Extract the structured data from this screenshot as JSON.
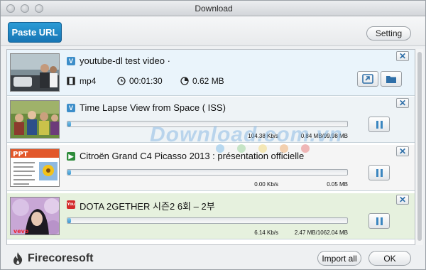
{
  "window": {
    "title": "Download"
  },
  "toolbar": {
    "paste_label": "Paste URL",
    "setting_label": "Setting"
  },
  "downloads": [
    {
      "source_icon": "vimeo-icon",
      "title": "youtube-dl test video ·",
      "format": "mp4",
      "duration": "00:01:30",
      "size": "0.62 MB",
      "status": "completed"
    },
    {
      "source_icon": "vimeo-icon",
      "title": "Time Lapse View from Space ( ISS)",
      "speed": "104.38 Kb/s",
      "progress_text": "0.84 MB/99.98 MB",
      "progress": 0.0084,
      "status": "downloading"
    },
    {
      "source_icon": "dailymotion-icon",
      "title": "Citroën Grand C4 Picasso 2013 : présentation officielle",
      "speed": "0.00 Kb/s",
      "progress_text": "0.05 MB",
      "progress": 0.005,
      "status": "downloading"
    },
    {
      "source_icon": "youtube-icon",
      "title": "DOTA 2GETHER 시즌2 6회 – 2부",
      "speed": "6.14 Kb/s",
      "progress_text": "2.47 MB/1062.04 MB",
      "progress": 0.0023,
      "status": "downloading"
    }
  ],
  "footer": {
    "brand": "Firecoresoft",
    "import_label": "Import all",
    "ok_label": "OK"
  },
  "watermark": {
    "text": "Download.com.vn"
  },
  "colors": {
    "accent": "#1f86c6",
    "progress_fill": "#4ba3d8",
    "completed_row": "#eaf4fb",
    "last_row": "#e6f1de"
  }
}
